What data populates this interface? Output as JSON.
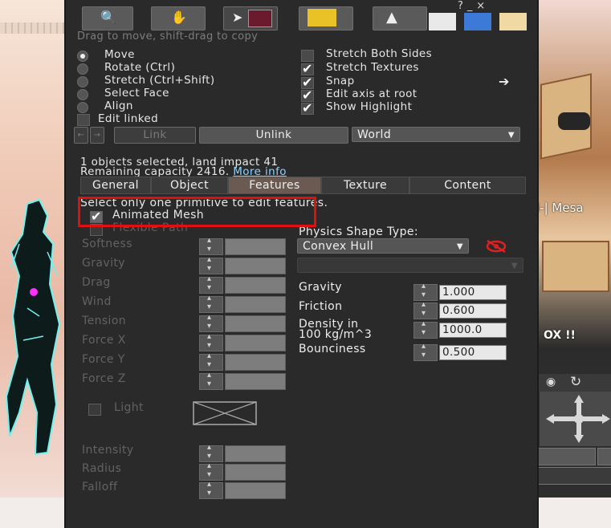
{
  "window": {
    "drag_hint": "Drag to move, shift-drag to copy",
    "title_glyphs": "? _ ×"
  },
  "edit_modes": [
    {
      "label": "Move",
      "selected": true
    },
    {
      "label": "Rotate (Ctrl)",
      "selected": false
    },
    {
      "label": "Stretch (Ctrl+Shift)",
      "selected": false
    },
    {
      "label": "Select Face",
      "selected": false
    },
    {
      "label": "Align",
      "selected": false
    }
  ],
  "edit_linked": {
    "label": "Edit linked",
    "checked": false
  },
  "options": [
    {
      "label": "Stretch Both Sides",
      "checked": false
    },
    {
      "label": "Stretch Textures",
      "checked": true
    },
    {
      "label": "Snap",
      "checked": true
    },
    {
      "label": "Edit axis at root",
      "checked": true
    },
    {
      "label": "Show Highlight",
      "checked": true
    }
  ],
  "link_bar": {
    "link": "Link",
    "unlink": "Unlink",
    "ruler": "World"
  },
  "selection_info": {
    "line1": "1 objects selected, land impact 41",
    "line2": "Remaining capacity 2416.",
    "more_info": "More info"
  },
  "tabs": [
    "General",
    "Object",
    "Features",
    "Texture",
    "Content"
  ],
  "active_tab": "Features",
  "features": {
    "notice": "Select only one primitive to edit features.",
    "animated_mesh": {
      "label": "Animated Mesh",
      "checked": true
    },
    "flexible_path": {
      "label": "Flexible Path",
      "checked": false
    },
    "flexi_props": [
      "Softness",
      "Gravity",
      "Drag",
      "Wind",
      "Tension",
      "Force X",
      "Force Y",
      "Force Z"
    ],
    "light": {
      "label": "Light",
      "checked": false
    },
    "light_props": [
      "Intensity",
      "Radius",
      "Falloff"
    ],
    "physics_shape_label": "Physics Shape Type:",
    "physics_shape_value": "Convex Hull",
    "physics": [
      {
        "label": "Gravity",
        "value": "1.000"
      },
      {
        "label": "Friction",
        "value": "0.600"
      },
      {
        "label": "Density in\n100 kg/m^3",
        "value": "1000.0"
      },
      {
        "label": "Bounciness",
        "value": "0.500"
      }
    ]
  },
  "scene": {
    "label_mesa": "l-| Mesa",
    "label_ox": "OX !!"
  },
  "colors": {
    "panel_bg": "#2a2a2a",
    "active_tab": "#6b5a52",
    "link": "#8fd1ff",
    "highlight_box": "#e01010"
  },
  "icons": [
    "focus-tool-icon",
    "grab-tool-icon",
    "create-tool-icon",
    "land-tool-icon",
    "eye-slash-icon",
    "navigation-arrows-icon"
  ]
}
